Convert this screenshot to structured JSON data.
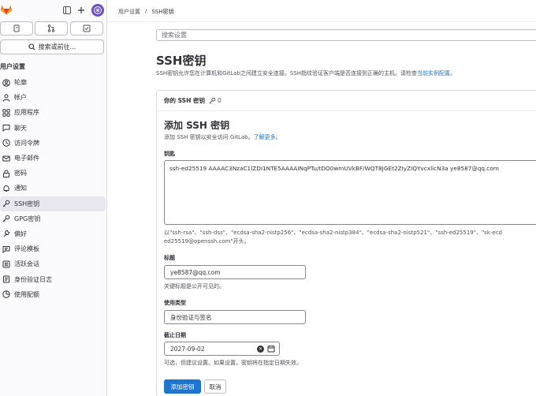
{
  "sidebar": {
    "search_label": "搜索或前往...",
    "section_title": "用户设置",
    "items": [
      {
        "label": "轮廓",
        "icon": "profile-icon"
      },
      {
        "label": "帐户",
        "icon": "account-icon"
      },
      {
        "label": "应用程序",
        "icon": "applications-icon"
      },
      {
        "label": "聊天",
        "icon": "chat-icon"
      },
      {
        "label": "访问令牌",
        "icon": "token-icon"
      },
      {
        "label": "电子邮件",
        "icon": "mail-icon"
      },
      {
        "label": "密码",
        "icon": "lock-icon"
      },
      {
        "label": "通知",
        "icon": "bell-icon"
      },
      {
        "label": "SSH密钥",
        "icon": "key-icon"
      },
      {
        "label": "GPG密钥",
        "icon": "key-icon"
      },
      {
        "label": "偏好",
        "icon": "preferences-icon"
      },
      {
        "label": "评论模板",
        "icon": "comment-template-icon"
      },
      {
        "label": "活跃会话",
        "icon": "sessions-icon"
      },
      {
        "label": "身份验证日志",
        "icon": "log-icon"
      },
      {
        "label": "使用配额",
        "icon": "quota-icon"
      }
    ]
  },
  "breadcrumb": {
    "parent": "用户设置",
    "separator": "/",
    "current": "SSH密钥"
  },
  "main": {
    "search_placeholder": "搜索设置",
    "title": "SSH密钥",
    "desc_prefix": "SSH密钥允许您在计算机和GitLab之间建立安全连接。SSH指纹验证客户端是否连接到正确的主机。请检查",
    "desc_link": "当前实例配置",
    "desc_suffix": "。",
    "card_title": "你的 SSH 密钥",
    "key_count": "0",
    "add_title": "添加 SSH 密钥",
    "add_desc_prefix": "添加 SSH 密钥以安全访问 GitLab。",
    "add_desc_link": "了解更多。",
    "key_label": "钥匙",
    "key_value": "ssh-ed25519 AAAAC3NzaC1lZDI1NTE5AAAAINqPTu/tDO0wmUVkBF/WQT8JGEt2ZIyZIQYvcxlicN3a ye8587@qq.com",
    "key_help_line1": "以\"ssh-rsa\"、\"ssh-dss\"、\"ecdsa-sha2-nistp256\"、\"ecdsa-sha2-nistp384\"、\"ecdsa-sha2-nistp521\"、\"ssh-ed25519\"、\"sk-ecd",
    "key_help_line2": "ed25519@openssh.com\"开头。",
    "title_label": "标题",
    "title_value": "ye8587@qq.com",
    "title_hint": "关键标题是公开可见的。",
    "usage_label": "使用类型",
    "usage_value": "身份验证与签名",
    "expiry_label": "截止日期",
    "expiry_value": "2027-09-02",
    "expiry_hint": "可选，但建议设置。如果设置，密钥将在指定日期失效。",
    "add_button": "添加密钥",
    "cancel_button": "取消"
  },
  "colors": {
    "primary": "#1f75cb",
    "brand": "#fc6d26",
    "active_bg": "#e8e6ef"
  }
}
